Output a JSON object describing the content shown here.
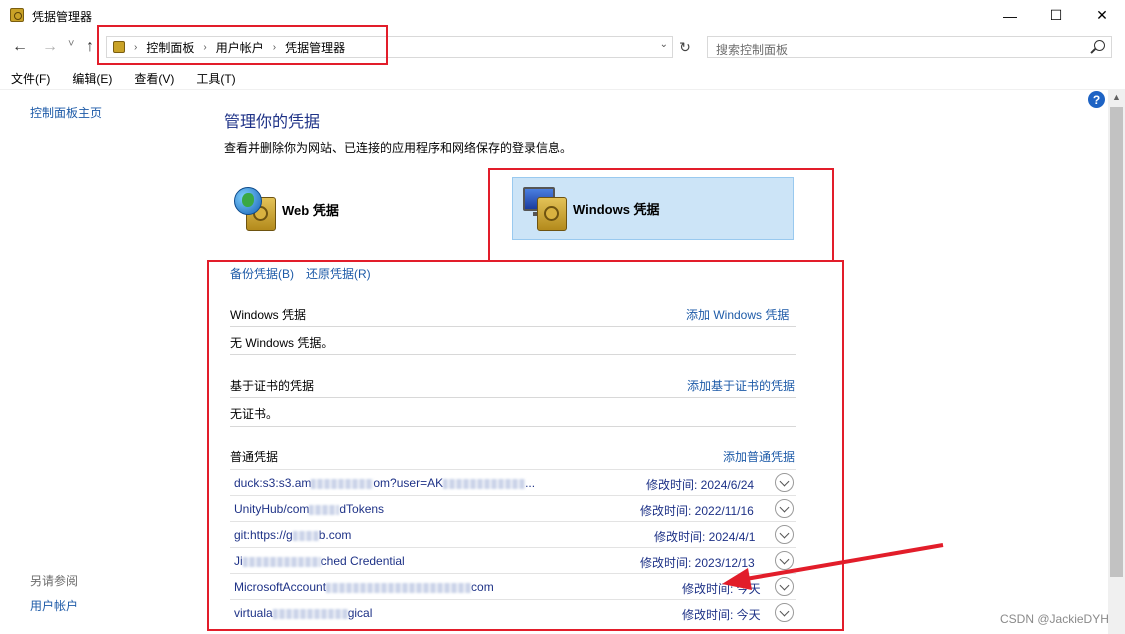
{
  "window": {
    "title": "凭据管理器",
    "min": "—",
    "max": "☐",
    "close": "✕"
  },
  "nav": {
    "back": "←",
    "forward": "→",
    "recent": "˅",
    "up": "↑",
    "breadcrumbs": [
      "控制面板",
      "用户帐户",
      "凭据管理器"
    ],
    "separator": "›",
    "dropdown": "⌄",
    "refresh": "↻"
  },
  "search": {
    "placeholder": "搜索控制面板"
  },
  "menu": [
    "文件(F)",
    "编辑(E)",
    "查看(V)",
    "工具(T)"
  ],
  "left": {
    "home_link": "控制面板主页",
    "see_also": "另请参阅",
    "user_accounts": "用户帐户"
  },
  "main": {
    "title": "管理你的凭据",
    "description": "查看并删除你为网站、已连接的应用程序和网络保存的登录信息。",
    "tiles": {
      "web": "Web 凭据",
      "windows": "Windows 凭据"
    },
    "backup": "备份凭据(B)",
    "restore": "还原凭据(R)",
    "sections": {
      "windows": {
        "title": "Windows 凭据",
        "add": "添加 Windows 凭据",
        "empty": "无 Windows 凭据。"
      },
      "cert": {
        "title": "基于证书的凭据",
        "add": "添加基于证书的凭据",
        "empty": "无证书。"
      },
      "generic": {
        "title": "普通凭据",
        "add": "添加普通凭据",
        "items": [
          {
            "name_a": "duck:s3:s3.am",
            "name_b": "om?user=AK",
            "name_c": "...",
            "modified": "修改时间:  2024/6/24"
          },
          {
            "name_a": "UnityHub/com",
            "name_b": "dTokens",
            "name_c": "",
            "modified": "修改时间:  2022/11/16"
          },
          {
            "name_a": "git:https://g",
            "name_b": "b.com",
            "name_c": "",
            "modified": "修改时间:  2024/4/1"
          },
          {
            "name_a": "Ji",
            "name_b": "ched Credential",
            "name_c": "",
            "modified": "修改时间:  2023/12/13"
          },
          {
            "name_a": "MicrosoftAccount",
            "name_b": "com",
            "name_c": "",
            "modified": "修改时间:  今天"
          },
          {
            "name_a": "virtuala",
            "name_b": "gical",
            "name_c": "",
            "modified": "修改时间:  今天"
          }
        ]
      }
    }
  },
  "help": "?",
  "watermark": "CSDN @JackieDYH",
  "colors": {
    "annotation": "#e21d2a",
    "link": "#1e5ba8",
    "selected_tile": "#cce4f7"
  }
}
